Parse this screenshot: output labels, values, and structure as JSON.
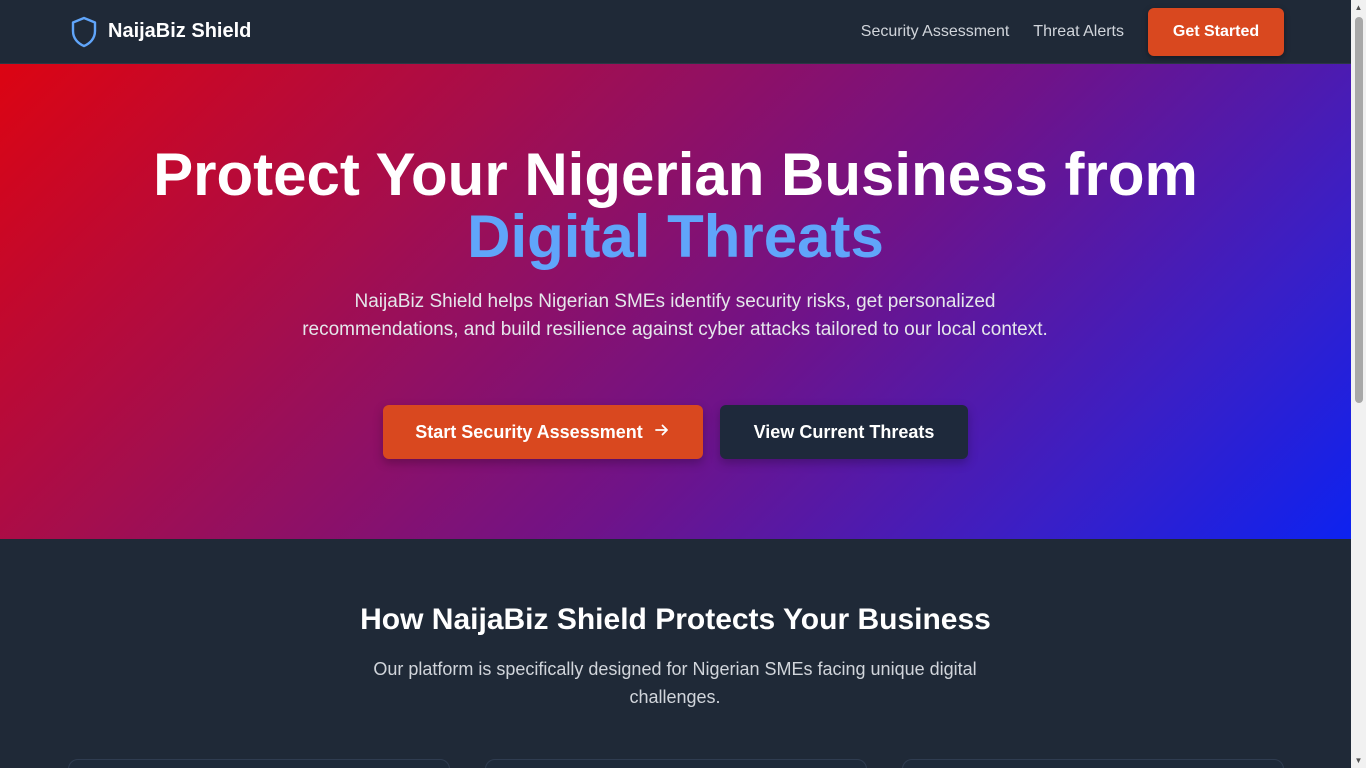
{
  "nav": {
    "brand_name": "NaijaBiz Shield",
    "brand_icon": "shield-icon",
    "links": [
      "Security Assessment",
      "Threat Alerts"
    ],
    "cta_label": "Get Started"
  },
  "hero": {
    "title_line1": "Protect Your Nigerian Business from",
    "title_accent": "Digital Threats",
    "description": "NaijaBiz Shield helps Nigerian SMEs identify security risks, get personalized recommendations, and build resilience against cyber attacks tailored to our local context.",
    "primary_button": "Start Security Assessment",
    "primary_button_icon": "arrow-right-icon",
    "secondary_button": "View Current Threats"
  },
  "features": {
    "title": "How NaijaBiz Shield Protects Your Business",
    "description": "Our platform is specifically designed for Nigerian SMEs facing unique digital challenges."
  },
  "colors": {
    "accent_orange": "#d9481f",
    "accent_blue": "#60a5fa",
    "background": "#1f2937",
    "hero_gradient_start": "#dc0412",
    "hero_gradient_end": "#0d22f0"
  }
}
